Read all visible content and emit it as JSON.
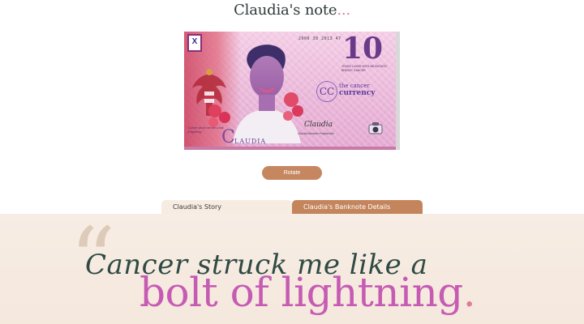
{
  "page": {
    "title": "Claudia's note",
    "title_suffix": "..."
  },
  "banknote": {
    "serial": "2006 38 2013 47",
    "denomination": "10",
    "tagline": "Years living with metastatic breast cancer",
    "brand_line1": "the cancer",
    "brand_line2": "currency",
    "brand_mark": "CC",
    "name": "C",
    "name_tail": "LAUDIA",
    "quote": "\"Cancer struck me like a bolt of lightning.\"",
    "signature": "Claudia",
    "signature_caption": "Claudia Altmann-Pospischek",
    "logo_glyph": "X",
    "colors": {
      "paper": "#eab9da",
      "denomination": "#6a3a8a",
      "flag_red": "#c9344f"
    }
  },
  "actions": {
    "rotate_label": "Rotate"
  },
  "tabs": [
    {
      "label": "Claudia's Story",
      "active": false
    },
    {
      "label": "Claudia's Banknote Details",
      "active": true
    }
  ],
  "story": {
    "quote_mark": "“",
    "line1": "Cancer struck me like a",
    "line2": "bolt of lightning",
    "line2_end": ".",
    "colors": {
      "line1": "#2f4a44",
      "line2": "#c65bb4",
      "accent": "#e07a9f"
    }
  }
}
